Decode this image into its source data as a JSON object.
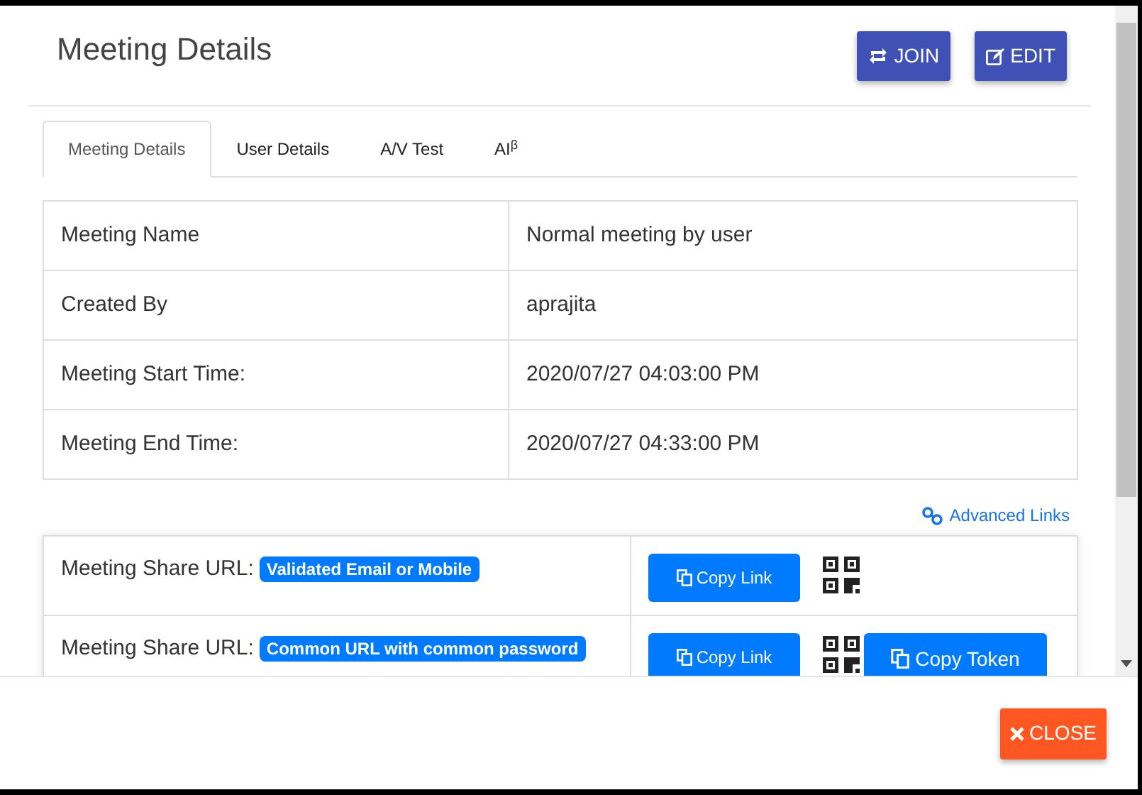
{
  "dialog": {
    "title": "Meeting Details",
    "header_buttons": [
      {
        "kind": "join",
        "label": "JOIN"
      },
      {
        "kind": "edit",
        "label": "EDIT"
      }
    ]
  },
  "tabs": [
    {
      "label": "Meeting Details",
      "selected": true
    },
    {
      "label": "User Details",
      "selected": false
    },
    {
      "label": "A/V Test",
      "selected": false
    },
    {
      "label": "AI$^{β}$",
      "selected": false
    }
  ],
  "details": [
    {
      "label": "Meeting Name",
      "value": "Normal meeting by user"
    },
    {
      "label": "Created By",
      "value": "aprajita"
    },
    {
      "label": "Meeting Start Time:",
      "value": "2020/07/27 04:03:00 PM"
    },
    {
      "label": "Meeting End Time:",
      "value": "2020/07/27 04:33:00 PM"
    }
  ],
  "advanced_links": "Advanced Links",
  "share_urls": [
    {
      "label": "Meeting Share URL:",
      "badge": "Validated Email or Mobile",
      "copy_link": "Copy Link"
    },
    {
      "label": "Meeting Share URL:",
      "badge": "Common URL with common password",
      "copy_link": "Copy Link",
      "copy_token": "Copy Token"
    }
  ],
  "footer": {
    "close": "CLOSE"
  }
}
